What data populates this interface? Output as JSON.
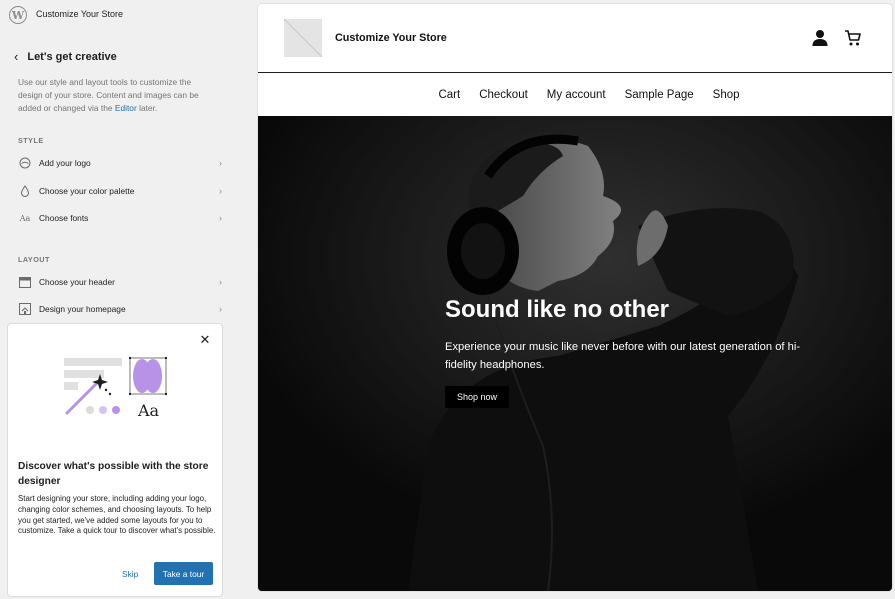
{
  "app": {
    "site_title": "Customize Your Store"
  },
  "sidebar": {
    "back_title": "Let's get creative",
    "intro_before": "Use our style and layout tools to customize the design of your store. Content and images can be added or changed via the ",
    "intro_link": "Editor",
    "intro_after": " later.",
    "style_label": "STYLE",
    "layout_label": "LAYOUT",
    "style_items": [
      {
        "label": "Add your logo",
        "icon": "logo-circle-icon"
      },
      {
        "label": "Choose your color palette",
        "icon": "droplet-icon"
      },
      {
        "label": "Choose fonts",
        "icon": "typography-icon"
      }
    ],
    "layout_items": [
      {
        "label": "Choose your header",
        "icon": "header-layout-icon"
      },
      {
        "label": "Design your homepage",
        "icon": "home-icon"
      }
    ]
  },
  "tour": {
    "illustration_text": "Aa",
    "title": "Discover what's possible with the store designer",
    "body": "Start designing your store, including adding your logo, changing color schemes, and choosing layouts. To help you get started, we've added some layouts for you to customize. Take a quick tour to discover what's possible.",
    "skip_label": "Skip",
    "start_label": "Take a tour"
  },
  "preview": {
    "store_title": "Customize Your Store",
    "nav": [
      "Cart",
      "Checkout",
      "My account",
      "Sample Page",
      "Shop"
    ],
    "hero": {
      "title": "Sound like no other",
      "text": "Experience your music like never before with our latest generation of hi-fidelity headphones.",
      "button": "Shop now"
    }
  },
  "colors": {
    "accent": "#2271b1",
    "sidebar_bg": "#f0f0f0",
    "hero_bg": "#0e0e0e"
  }
}
